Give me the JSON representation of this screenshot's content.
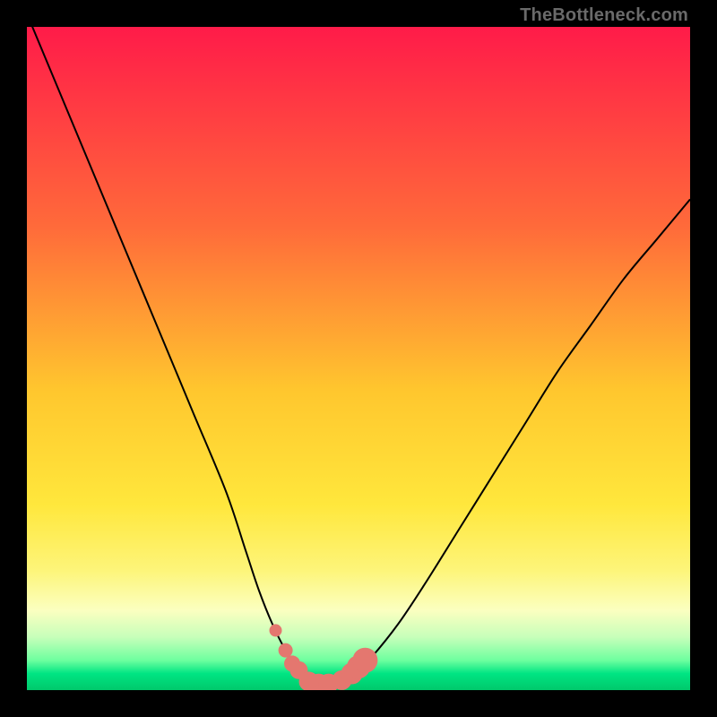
{
  "watermark": "TheBottleneck.com",
  "colors": {
    "frame": "#000000",
    "curve": "#000000",
    "marker_fill": "#e4776f",
    "marker_stroke": "#c95a52",
    "gradient_stops": [
      {
        "offset": 0.0,
        "color": "#ff1b49"
      },
      {
        "offset": 0.3,
        "color": "#ff6a3a"
      },
      {
        "offset": 0.55,
        "color": "#ffc72e"
      },
      {
        "offset": 0.72,
        "color": "#ffe73c"
      },
      {
        "offset": 0.82,
        "color": "#fdf57a"
      },
      {
        "offset": 0.88,
        "color": "#fbffc0"
      },
      {
        "offset": 0.92,
        "color": "#c7ffba"
      },
      {
        "offset": 0.955,
        "color": "#6eff9f"
      },
      {
        "offset": 0.975,
        "color": "#00e583"
      },
      {
        "offset": 1.0,
        "color": "#00c86b"
      }
    ]
  },
  "chart_data": {
    "type": "line",
    "title": "",
    "xlabel": "",
    "ylabel": "",
    "xlim": [
      0,
      100
    ],
    "ylim": [
      0,
      100
    ],
    "grid": false,
    "series": [
      {
        "name": "bottleneck-curve",
        "x": [
          0,
          5,
          10,
          15,
          20,
          25,
          30,
          33,
          35,
          37,
          39,
          41,
          43,
          45,
          47,
          49,
          52,
          56,
          60,
          65,
          70,
          75,
          80,
          85,
          90,
          95,
          100
        ],
        "values": [
          102,
          90,
          78,
          66,
          54,
          42,
          30,
          21,
          15,
          10,
          6,
          3,
          1,
          1,
          1,
          2,
          5,
          10,
          16,
          24,
          32,
          40,
          48,
          55,
          62,
          68,
          74
        ]
      }
    ],
    "markers": {
      "name": "highlight-markers",
      "x": [
        37.5,
        39.0,
        40.0,
        41.0,
        42.5,
        44.0,
        45.5,
        47.5,
        49.0,
        50.0,
        51.0
      ],
      "values": [
        9.0,
        6.0,
        4.0,
        3.0,
        1.3,
        1.0,
        1.0,
        1.5,
        2.5,
        3.5,
        4.5
      ],
      "size": [
        7,
        8,
        9,
        10,
        11,
        11,
        11,
        11,
        12,
        13,
        14
      ]
    }
  }
}
